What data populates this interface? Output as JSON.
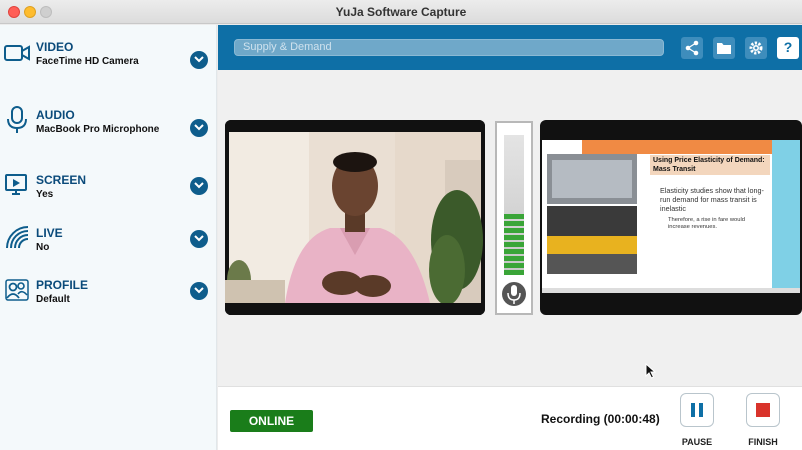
{
  "window": {
    "title": "YuJa Software Capture"
  },
  "sidebar": {
    "items": [
      {
        "title": "VIDEO",
        "value": "FaceTime HD Camera",
        "icon": "video-camera-icon"
      },
      {
        "title": "AUDIO",
        "value": "MacBook Pro Microphone",
        "icon": "microphone-icon"
      },
      {
        "title": "SCREEN",
        "value": "Yes",
        "icon": "screen-icon"
      },
      {
        "title": "LIVE",
        "value": "No",
        "icon": "broadcast-icon"
      },
      {
        "title": "PROFILE",
        "value": "Default",
        "icon": "users-icon"
      }
    ]
  },
  "toolbar": {
    "search_placeholder": "Supply & Demand",
    "buttons": [
      "share-icon",
      "folder-icon",
      "gear-icon",
      "help-icon"
    ],
    "help_label": "?"
  },
  "slide": {
    "heading": "Using Price Elasticity of Demand: Mass Transit",
    "bullet": "Elasticity studies show that long-run demand for mass transit is inelastic",
    "sub_bullet": "Therefore, a rise in fare would increase revenues."
  },
  "meter": {
    "level": 0.43
  },
  "bottom": {
    "status": "ONLINE",
    "recording": "Recording (00:00:48)",
    "pause_label": "PAUSE",
    "finish_label": "FINISH"
  },
  "colors": {
    "accent": "#0e6fa6",
    "online": "#1a7d1a",
    "stop": "#d9332b"
  }
}
